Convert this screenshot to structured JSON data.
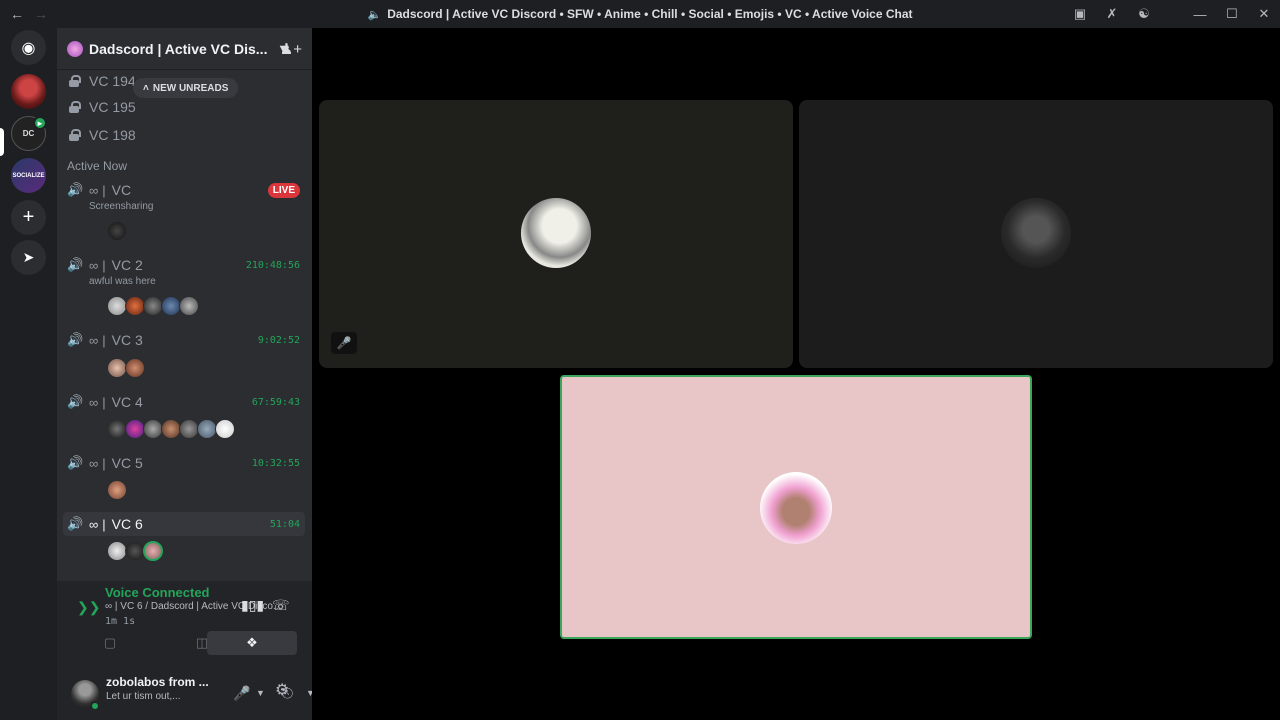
{
  "titlebar": {
    "back_icon": "arrow-left-icon",
    "forward_icon": "arrow-right-icon",
    "title": "Dadscord | Active VC Discord • SFW • Anime • Chill • Social • Emojis • VC • Active Voice Chat"
  },
  "server": {
    "name": "Dadscord | Active VC Dis...",
    "badge_count": "1"
  },
  "locked_channels": [
    "VC 194",
    "VC 195",
    "VC 198"
  ],
  "new_unreads_label": "NEW UNREADS",
  "section_title": "Active Now",
  "voice_channels": [
    {
      "name": "VC",
      "subtitle": "Screensharing",
      "status": "LIVE"
    },
    {
      "name": "VC 2",
      "subtitle": "awful was here",
      "timer": "210:48:56"
    },
    {
      "name": "VC 3",
      "timer": "9:02:52"
    },
    {
      "name": "VC 4",
      "timer": "67:59:43"
    },
    {
      "name": "VC 5",
      "timer": "10:32:55"
    },
    {
      "name": "VC 6",
      "timer": "51:04"
    }
  ],
  "infinity_symbol": "∞",
  "separator": "|",
  "voice_panel": {
    "title": "Voice Connected",
    "subtitle": "∞ | VC 6 / Dadscord | Active VC Disco...",
    "elapsed": "1m 1s"
  },
  "user": {
    "name": "zobolabos from ...",
    "status": "Let ur tism out,..."
  },
  "colors": {
    "accent_green": "#23a559",
    "live_red": "#da373c",
    "speaking_border": "#3ba55c",
    "sidebar_bg": "#2b2d31",
    "rail_bg": "#1e1f22"
  }
}
